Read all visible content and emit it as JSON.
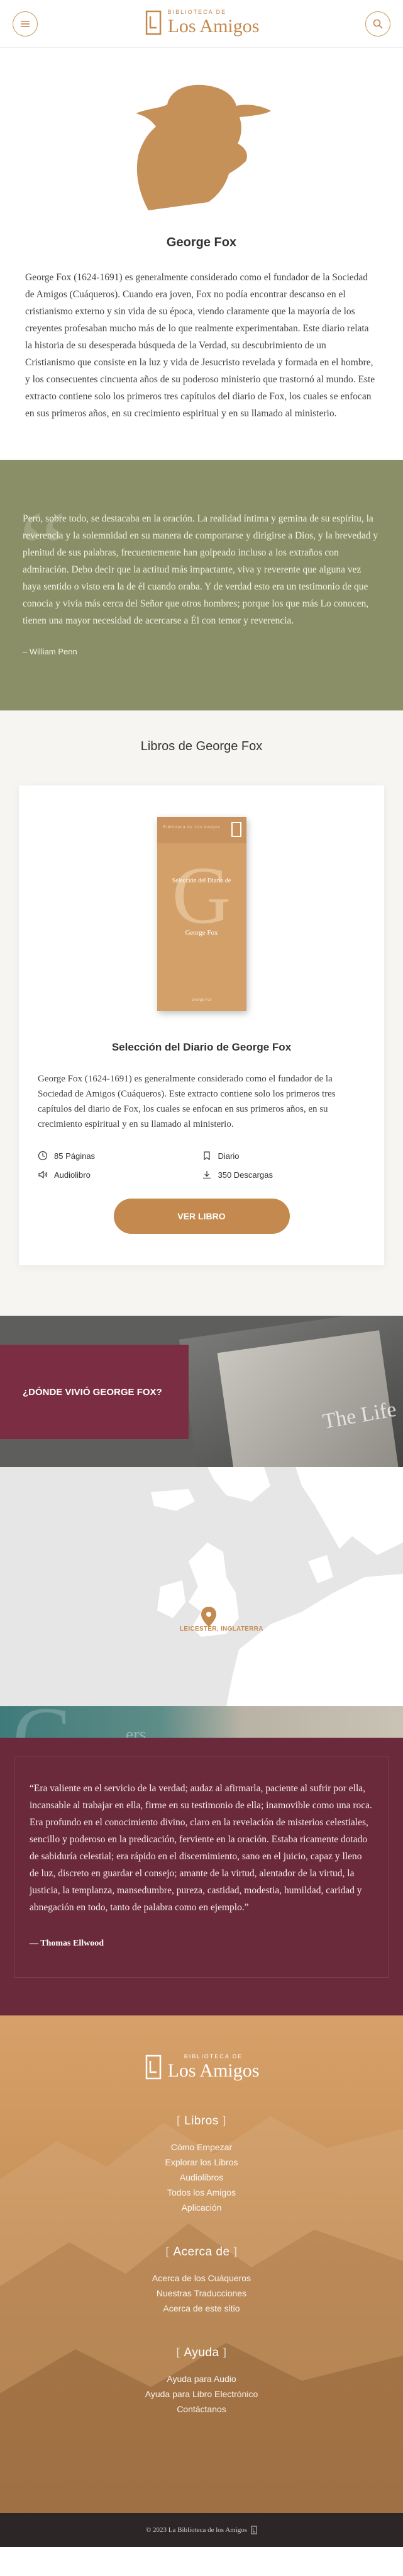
{
  "header": {
    "logo_small": "Biblioteca de",
    "logo_big": "Los Amigos"
  },
  "author": {
    "name": "George Fox",
    "bio": "George Fox (1624-1691) es generalmente considerado como el fundador de la Sociedad de Amigos (Cuáqueros). Cuando era joven, Fox no podía encontrar descanso en el cristianismo externo y sin vida de su época, viendo claramente que la mayoría de los creyentes profesaban mucho más de lo que realmente experimentaban. Este diario relata la historia de su desesperada búsqueda de la Verdad, su descubrimiento de un Cristianismo que consiste en la luz y vida de Jesucristo revelada y formada en el hombre, y los consecuentes cincuenta años de su poderoso ministerio que trastornó al mundo. Este extracto contiene solo los primeros tres capítulos del diario de Fox, los cuales se enfocan en sus primeros años, en su crecimiento espiritual y en su llamado al ministerio."
  },
  "quote1": {
    "text": "Pero, sobre todo, se destacaba en la oración. La realidad íntima y gemina de su espíritu, la reverencia y la solemnidad en su manera de comportarse y dirigirse a Dios, y la brevedad y plenitud de sus palabras, frecuentemente han golpeado incluso a los extraños con admiración. Debo decir que la actitud más impactante, viva y reverente que alguna vez haya sentido o visto era la de él cuando oraba. Y de verdad esto era un testimonio de que conocía y vivía más cerca del Señor que otros hombres; porque los que más Lo conocen, tienen una mayor necesidad de acercarse a Él con temor y reverencia.",
    "cite": "– William Penn"
  },
  "books": {
    "heading": "Libros de George Fox",
    "items": [
      {
        "cover_small": "Biblioteca de Los Amigos",
        "cover_letter": "G",
        "cover_title": "Selección del Diario de",
        "cover_author": "George Fox",
        "cover_bottom": "George Fox",
        "title": "Selección del Diario de George Fox",
        "description": "George Fox (1624-1691) es generalmente considerado como el fundador de la Sociedad de Amigos (Cuáqueros). Este extracto contiene solo los primeros tres capítulos del diario de Fox, los cuales se enfocan en sus primeros años, en su crecimiento espiritual y en su llamado al ministerio.",
        "pages": "85 Páginas",
        "type": "Diario",
        "audio": "Audiolibro",
        "downloads": "350 Descargas",
        "button": "VER LIBRO"
      }
    ]
  },
  "lived": {
    "label": "¿DÓNDE VIVIÓ GEORGE FOX?",
    "bg_text": "The Life"
  },
  "map": {
    "pin_label": "LEICESTER, INGLATERRA"
  },
  "band": {
    "bg_text": "ers"
  },
  "quote2": {
    "text": "“Era valiente en el servicio de la verdad; audaz al afirmarla, paciente al sufrir por ella, incansable al trabajar en ella, firme en su testimonio de ella; inamovible como una roca. Era profundo en el conocimiento divino, claro en la revelación de misterios celestiales, sencillo y poderoso en la predicación, ferviente en la oración. Estaba ricamente dotado de sabiduría celestial; era rápido en el discernimiento, sano en el juicio, capaz y lleno de luz, discreto en guardar el consejo; amante de la virtud, alentador de la virtud, la justicia, la templanza, mansedumbre, pureza, castidad, modestia, humildad, caridad y abnegación en todo, tanto de palabra como en ejemplo.”",
    "cite": "— Thomas Ellwood"
  },
  "footer": {
    "logo_small": "Biblioteca de",
    "logo_big": "Los Amigos",
    "sections": [
      {
        "title": "Libros",
        "links": [
          "Cómo Empezar",
          "Explorar los Libros",
          "Audiolibros",
          "Todos los Amigos",
          "Aplicación"
        ]
      },
      {
        "title": "Acerca de",
        "links": [
          "Acerca de los Cuáqueros",
          "Nuestras Traducciones",
          "Acerca de este sitio"
        ]
      },
      {
        "title": "Ayuda",
        "links": [
          "Ayuda para Audio",
          "Ayuda para Libro Electrónico",
          "Contáctanos"
        ]
      }
    ],
    "copyright": "© 2023 La Biblioteca de los Amigos"
  },
  "colors": {
    "accent": "#c3894f",
    "olive": "#8b8f67",
    "wine": "#6b2a3c"
  }
}
